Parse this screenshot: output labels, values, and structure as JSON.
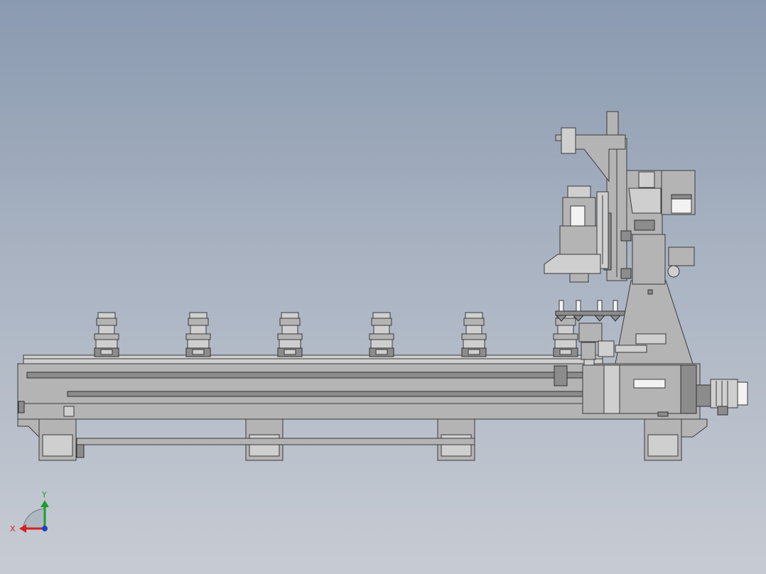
{
  "triad": {
    "x_label": "X",
    "y_label": "Y",
    "x_color": "#d42020",
    "y_color": "#1a9e2a",
    "z_color": "#2040c8"
  },
  "model": {
    "body_color": "#b4b4b4",
    "outline_color": "#3a3a3a",
    "holder_count": 6,
    "tool_count": 4
  }
}
